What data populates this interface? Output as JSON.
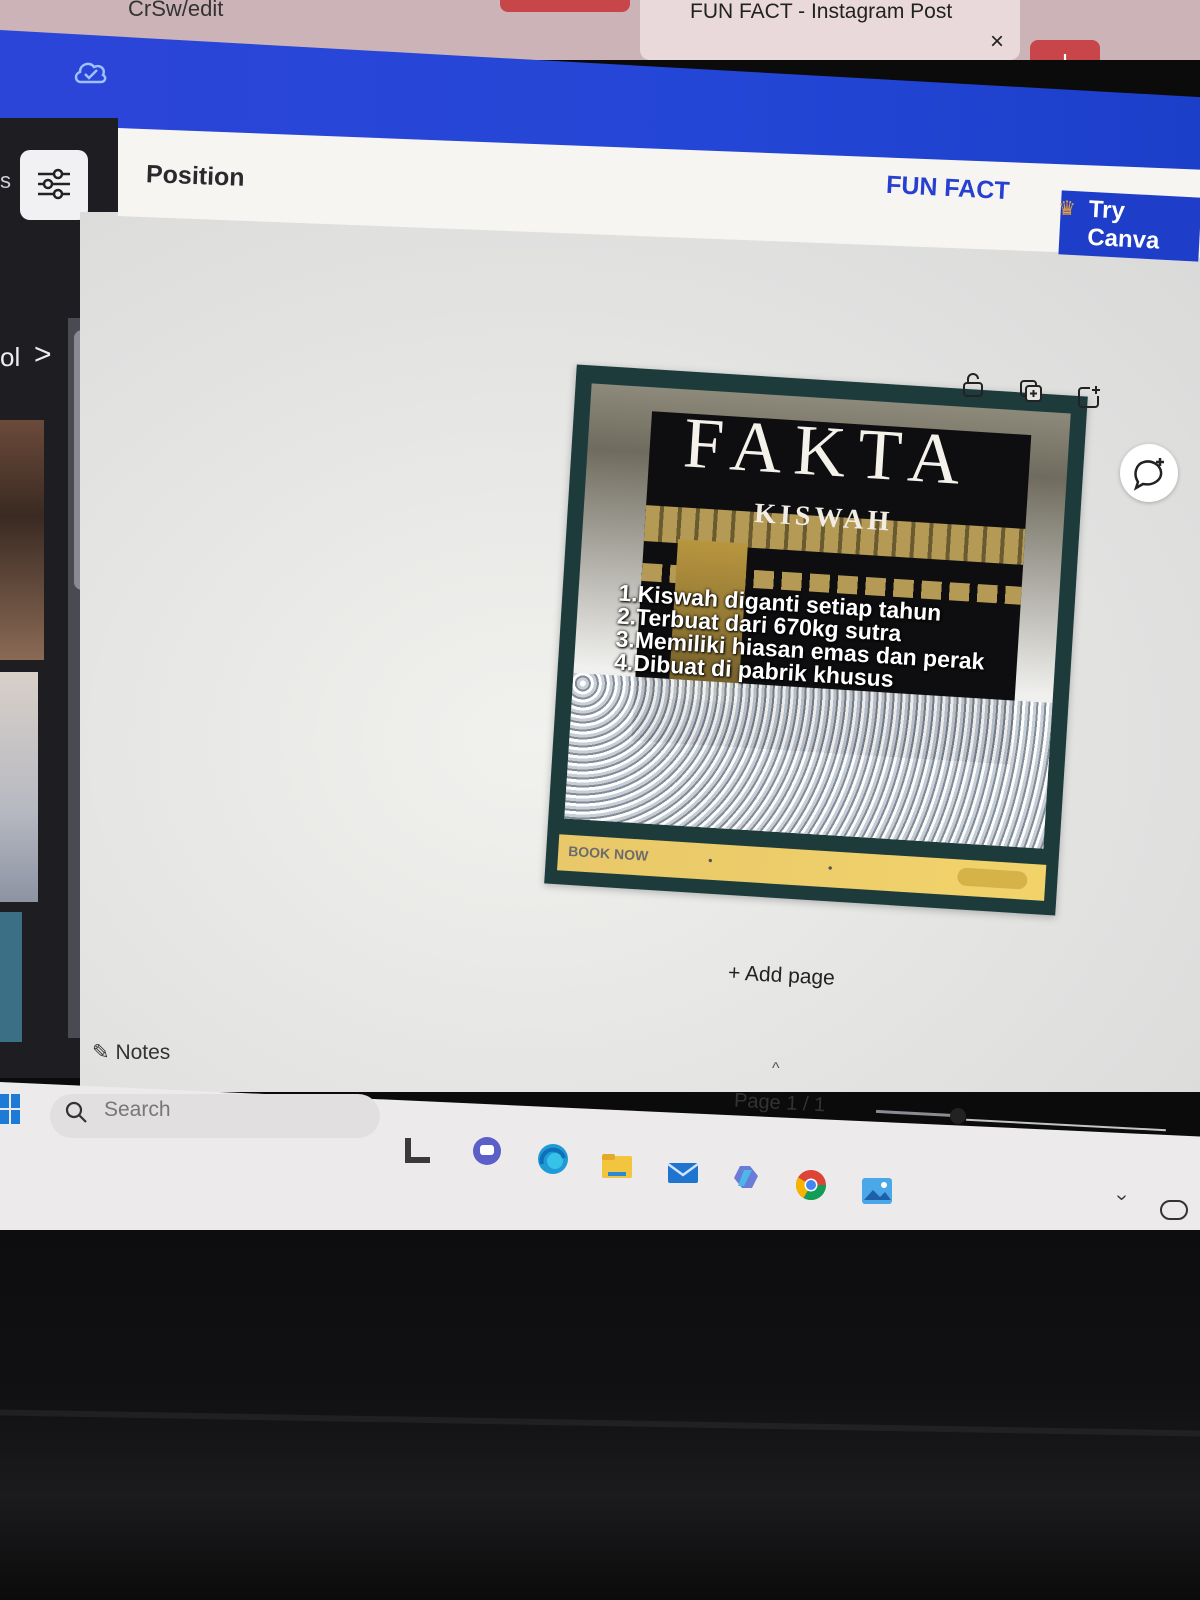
{
  "browser": {
    "url_fragment": "CrSw/edit",
    "tab_title": "FUN FACT - Instagram Post",
    "tab_close": "×",
    "new_tab": "+"
  },
  "sidebar": {
    "label_s": "s",
    "label_ol": "ol",
    "chevron": ">",
    "collapse": "‹"
  },
  "toolbar": {
    "position_label": "Position",
    "design_title": "FUN FACT",
    "try_canva_label": "Try Canva"
  },
  "design": {
    "title": "FAKTA",
    "subtitle": "KISWAH",
    "facts": [
      "1.Kiswah diganti setiap tahun",
      "2.Terbuat dari 670kg sutra",
      "3.Memiliki hiasan emas dan perak",
      "4.Dibuat di pabrik khusus"
    ],
    "footer_cta": "BOOK NOW"
  },
  "canvas": {
    "add_page_label": "+ Add page",
    "notes_label": "Notes",
    "page_indicator": "Page 1 / 1"
  },
  "taskbar": {
    "search_placeholder": "Search"
  },
  "colors": {
    "canva_blue": "#2446d6",
    "tab_red": "#c8464a",
    "design_frame": "#1d3b3b",
    "footer_yellow": "#f2d36a"
  }
}
